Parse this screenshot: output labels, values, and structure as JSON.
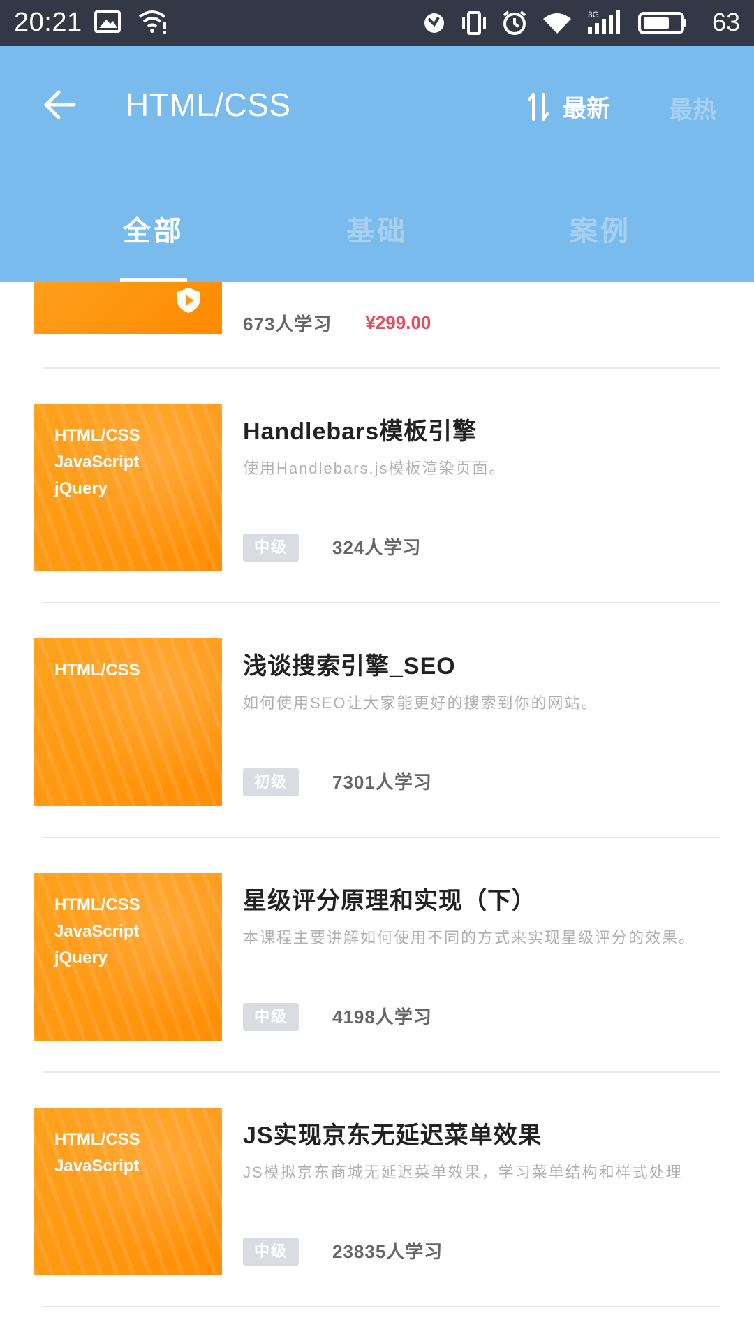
{
  "status": {
    "time": "20:21",
    "battery": "63",
    "network": "3G"
  },
  "header": {
    "title": "HTML/CSS",
    "sort_newest": "最新",
    "sort_hot": "最热"
  },
  "tabs": [
    {
      "label": "全部"
    },
    {
      "label": "基础"
    },
    {
      "label": "案例"
    }
  ],
  "partial": {
    "learners": "673人学习",
    "price": "¥299.00"
  },
  "courses": [
    {
      "title": "Handlebars模板引擎",
      "desc": "使用Handlebars.js模板渲染页面。",
      "level": "中级",
      "learners": "324人学习",
      "tags": [
        "HTML/CSS",
        "JavaScript",
        "jQuery"
      ]
    },
    {
      "title": "浅谈搜索引擎_SEO",
      "desc": "如何使用SEO让大家能更好的搜索到你的网站。",
      "level": "初级",
      "learners": "7301人学习",
      "tags": [
        "HTML/CSS"
      ]
    },
    {
      "title": "星级评分原理和实现（下）",
      "desc": "本课程主要讲解如何使用不同的方式来实现星级评分的效果。",
      "level": "中级",
      "learners": "4198人学习",
      "tags": [
        "HTML/CSS",
        "JavaScript",
        "jQuery"
      ]
    },
    {
      "title": "JS实现京东无延迟菜单效果",
      "desc": "JS模拟京东商城无延迟菜单效果，学习菜单结构和样式处理",
      "level": "中级",
      "learners": "23835人学习",
      "tags": [
        "HTML/CSS",
        "JavaScript"
      ]
    }
  ],
  "colors": {
    "status_bar": "#343846",
    "header": "#7abbed",
    "price": "#e84a5f",
    "thumb": "#ff9a12"
  },
  "icons": {
    "back": "arrow-left-icon",
    "sort": "sort-icon",
    "play_badge": "play-badge-icon"
  }
}
